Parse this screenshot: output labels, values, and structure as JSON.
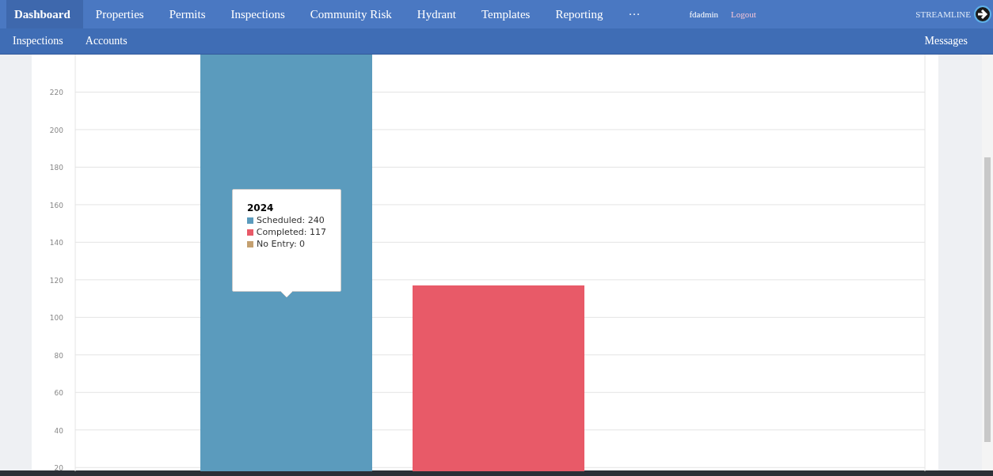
{
  "nav": {
    "items": [
      {
        "label": "Dashboard",
        "selected": true
      },
      {
        "label": "Properties",
        "selected": false
      },
      {
        "label": "Permits",
        "selected": false
      },
      {
        "label": "Inspections",
        "selected": false
      },
      {
        "label": "Community Risk",
        "selected": false
      },
      {
        "label": "Hydrant",
        "selected": false
      },
      {
        "label": "Templates",
        "selected": false
      },
      {
        "label": "Reporting",
        "selected": false
      },
      {
        "label": "···",
        "selected": false
      }
    ],
    "user": "fdadmin",
    "logout": "Logout",
    "brand": "STREAMLINE"
  },
  "subnav": {
    "items": [
      "Inspections",
      "Accounts"
    ],
    "right": "Messages"
  },
  "chart": {
    "chart_data": {
      "type": "bar",
      "categories": [
        "2024"
      ],
      "series": [
        {
          "name": "Scheduled",
          "color": "#5b9bbd",
          "values": [
            240
          ]
        },
        {
          "name": "Completed",
          "color": "#e85a68",
          "values": [
            117
          ]
        },
        {
          "name": "No Entry",
          "color": "#c4a070",
          "values": [
            null
          ]
        }
      ],
      "ylim": [
        18,
        240
      ],
      "yticks": [
        20,
        40,
        60,
        80,
        100,
        120,
        140,
        160,
        180,
        200,
        220
      ],
      "grid": true
    },
    "tooltip": {
      "separator": ":",
      "values": [
        "240",
        "117",
        "0"
      ]
    }
  }
}
